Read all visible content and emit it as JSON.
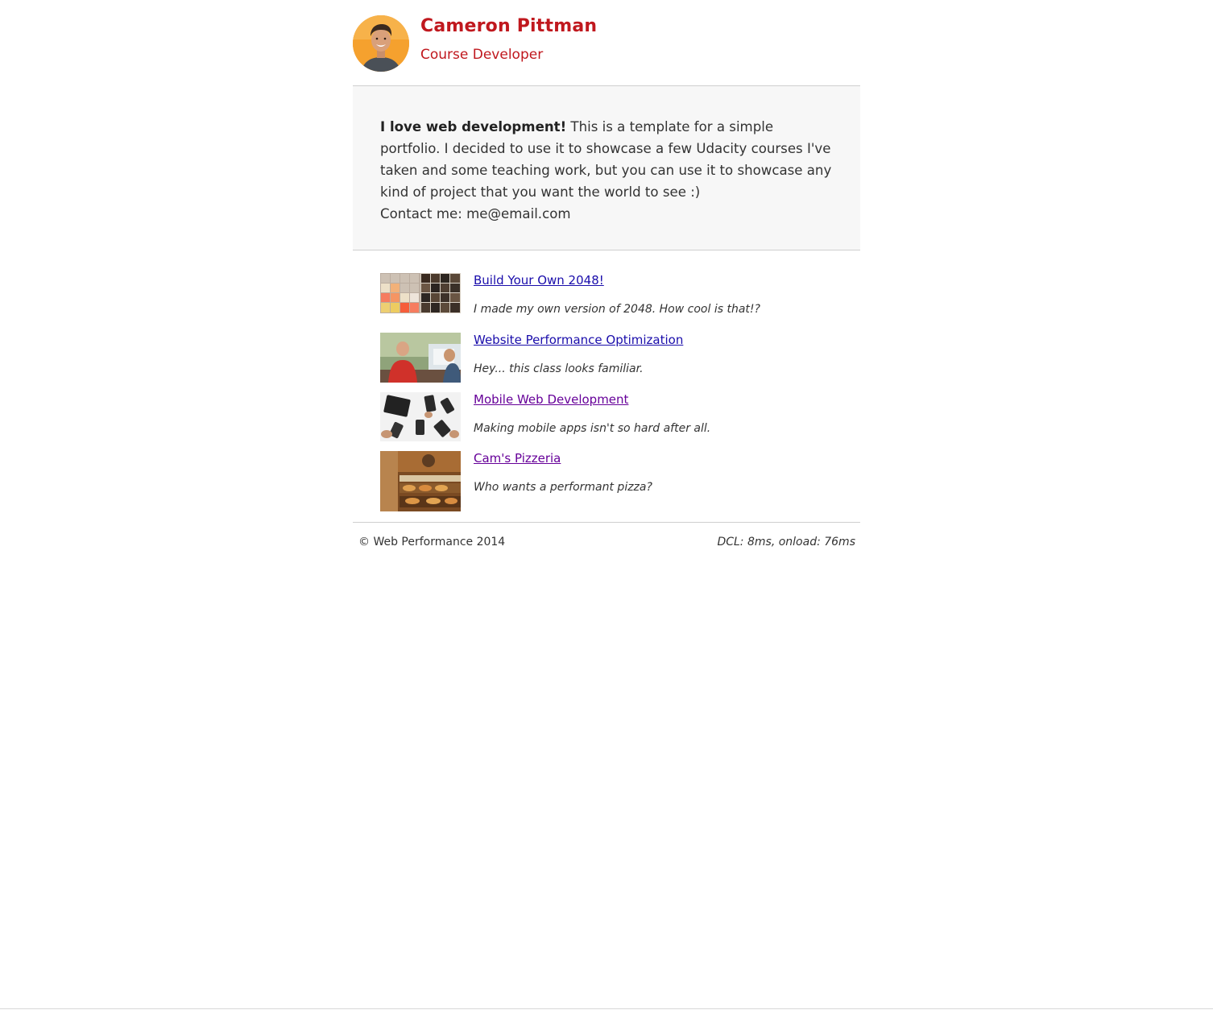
{
  "header": {
    "name": "Cameron Pittman",
    "role": "Course Developer",
    "avatar_icon": "profile-photo"
  },
  "intro": {
    "lead": "I love web development!",
    "body": " This is a template for a simple portfolio. I decided to use it to showcase a few Udacity courses I've taken and some teaching work, but you can use it to showcase any kind of project that you want the world to see :)",
    "contact": "Contact me: me@email.com"
  },
  "projects": [
    {
      "title": "Build Your Own 2048!",
      "description": "I made my own version of 2048. How cool is that!?",
      "thumbnail": "2048-game-thumbnail",
      "visited": false
    },
    {
      "title": "Website Performance Optimization",
      "description": "Hey... this class looks familiar.",
      "thumbnail": "instructor-photo-thumbnail",
      "visited": false
    },
    {
      "title": "Mobile Web Development",
      "description": "Making mobile apps isn't so hard after all.",
      "thumbnail": "mobile-devices-thumbnail",
      "visited": true
    },
    {
      "title": "Cam's Pizzeria",
      "description": "Who wants a performant pizza?",
      "thumbnail": "pizzeria-thumbnail",
      "visited": true
    }
  ],
  "footer": {
    "copyright": "© Web Performance 2014",
    "perf": "DCL: 8ms, onload: 76ms"
  },
  "colors": {
    "accent": "#c0181e",
    "link": "#1a0dab",
    "link_visited": "#660099",
    "intro_bg": "#f7f7f7"
  }
}
